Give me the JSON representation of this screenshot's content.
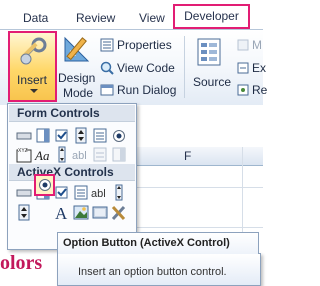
{
  "tabs": [
    "Data",
    "Review",
    "View",
    "Developer"
  ],
  "ribbon": {
    "insert_label": "Insert",
    "design_mode_line1": "Design",
    "design_mode_line2": "Mode",
    "properties": "Properties",
    "view_code": "View Code",
    "run_dialog": "Run Dialog",
    "source": "Source",
    "partial_labels": [
      "M",
      "Ex",
      "Re"
    ]
  },
  "menu": {
    "form_controls_header": "Form Controls",
    "activex_controls_header": "ActiveX Controls",
    "form_icons": [
      "button-icon",
      "combo-box-icon",
      "check-box-icon",
      "spin-button-icon",
      "list-box-icon",
      "option-button-icon",
      "group-box-icon",
      "label-icon",
      "scroll-bar-icon",
      "text-field-icon",
      "combo-list-edit-icon",
      "combo-drop-edit-icon"
    ],
    "activex_icons": [
      "command-button-icon",
      "combo-box-icon",
      "check-box-icon",
      "list-box-icon",
      "text-box-icon",
      "scroll-bar-icon",
      "spin-button-icon",
      "option-button-icon",
      "label-icon",
      "image-icon",
      "toggle-button-icon",
      "more-controls-icon"
    ]
  },
  "sheet": {
    "col_header": "F",
    "cell_fragment": "olors"
  },
  "tooltip": {
    "title": "Option Button (ActiveX Control)",
    "description": "Insert an option button control."
  },
  "colors": {
    "highlight": "#e21d74",
    "ribbon_bg": "#e3ebf5",
    "cell_text": "#c2185b"
  }
}
